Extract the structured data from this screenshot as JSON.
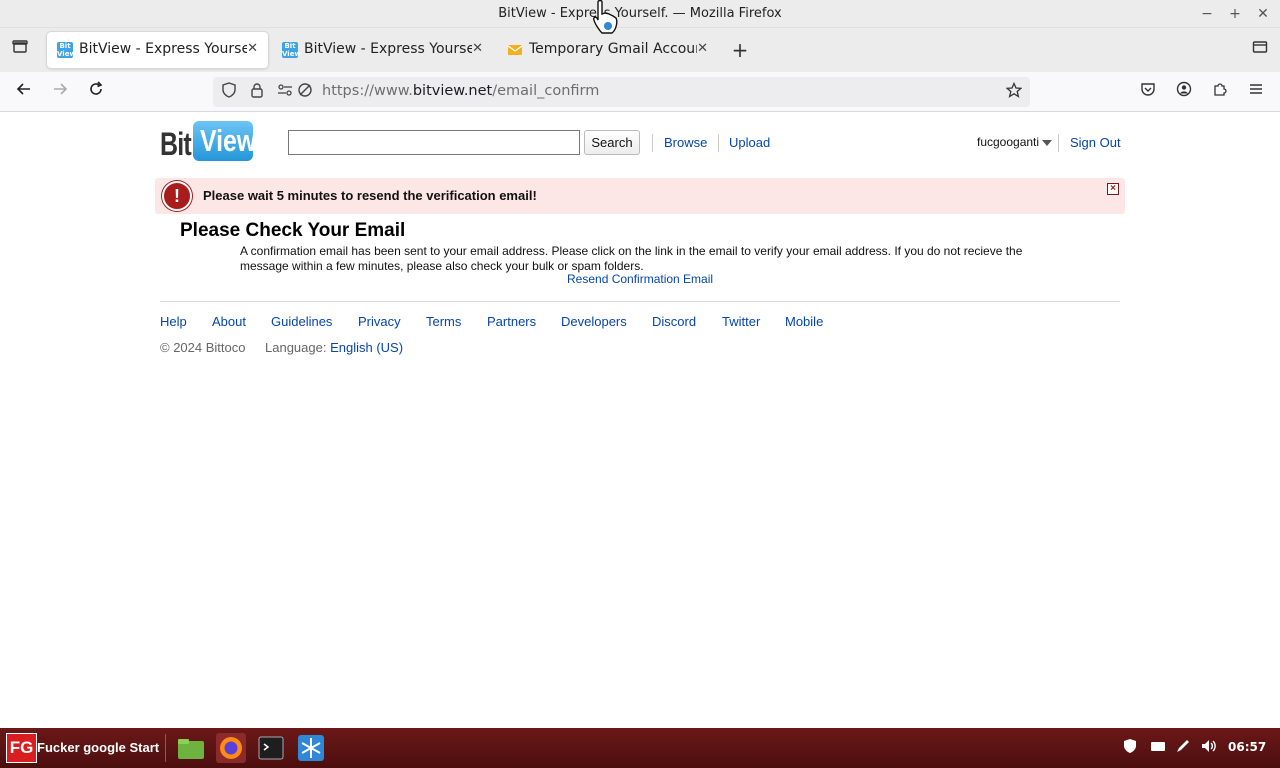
{
  "window": {
    "title": "BitView - Express Yourself. — Mozilla Firefox"
  },
  "tabs": [
    {
      "label": "BitView - Express Yourself.",
      "favicon": "bitview-favicon",
      "active": true
    },
    {
      "label": "BitView - Express Yourself.",
      "favicon": "bitview-favicon",
      "active": false
    },
    {
      "label": "Temporary Gmail Account",
      "favicon": "mail-envelope-icon",
      "active": false
    }
  ],
  "navbar": {
    "url_prefix": "https://www.",
    "url_domain": "bitview.net",
    "url_path": "/email_confirm"
  },
  "site": {
    "logo_bit": "Bit",
    "logo_view": "View",
    "search_button": "Search",
    "browse": "Browse",
    "upload": "Upload",
    "username": "fucgooganti",
    "sign_out": "Sign Out"
  },
  "alert": {
    "message": "Please wait 5 minutes to resend the verification email!",
    "badge": "!",
    "color": "#fde6e6"
  },
  "content": {
    "heading": "Please Check Your Email",
    "body": "A confirmation email has been sent to your email address. Please click on the link in the email to verify your email address. If you do not recieve the message within a few minutes, please also check your bulk or spam folders.",
    "resend": "Resend Confirmation Email"
  },
  "footer": {
    "links": [
      "Help",
      "About",
      "Guidelines",
      "Privacy",
      "Terms",
      "Partners",
      "Developers",
      "Discord",
      "Twitter",
      "Mobile"
    ],
    "copyright": "© 2024 Bittoco",
    "language_label": "Language:",
    "language_value": "English (US)"
  },
  "taskbar": {
    "start_logo": "FG",
    "start_label": "Fucker google Start",
    "clock": "06:57",
    "accent": "#d81e1e"
  }
}
